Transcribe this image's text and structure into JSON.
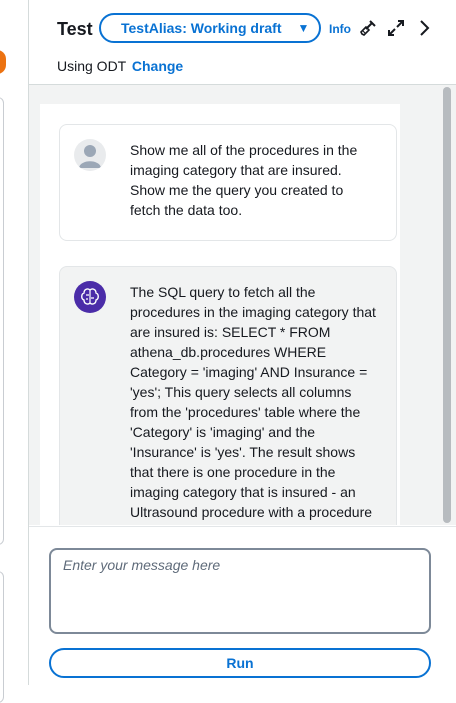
{
  "header": {
    "title": "Test",
    "alias_selected": "TestAlias: Working draft",
    "info_label": "Info",
    "using_label": "Using ODT",
    "change_label": "Change",
    "icons": [
      "brush-icon",
      "expand-icon",
      "chevron-right-icon"
    ]
  },
  "messages": [
    {
      "role": "user",
      "text": "Show me all of the procedures in the imaging category that are insured. Show me the query you created to fetch the data too."
    },
    {
      "role": "agent",
      "text": "The SQL query to fetch all the procedures in the imaging category that are insured is: SELECT * FROM athena_db.procedures WHERE Category = 'imaging' AND Insurance = 'yes'; This query selects all columns from the 'procedures' table where the 'Category' is 'imaging' and the 'Insurance' is 'yes'. The result shows that there is one procedure in the imaging category that is insured - an Ultrasound procedure with a procedure"
    }
  ],
  "composer": {
    "placeholder": "Enter your message here",
    "value": "",
    "run_label": "Run"
  },
  "colors": {
    "accent": "#0972d3",
    "agent_avatar": "#4b2ca8",
    "bot_bubble": "#f2f3f3",
    "left_indicator": "#ec7211"
  }
}
